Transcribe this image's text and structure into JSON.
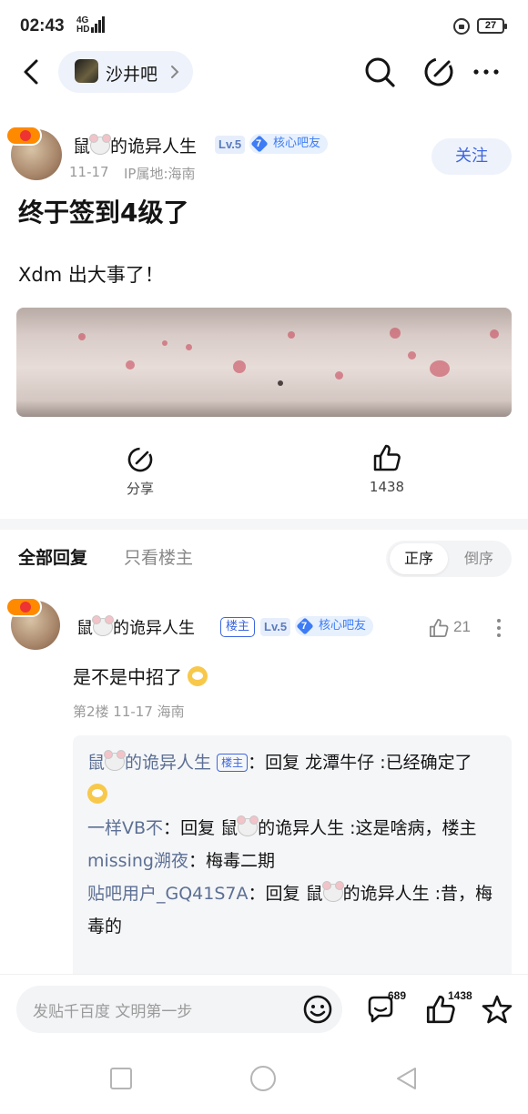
{
  "status_bar": {
    "time": "02:43",
    "signal": "4G",
    "signal_hd": "HD",
    "battery": "27"
  },
  "nav": {
    "forum_name": "沙井吧"
  },
  "post": {
    "author": "鼠",
    "author_suffix": "的诡异人生",
    "level": "Lv.5",
    "core_level": "7",
    "core_label": "核心吧友",
    "date": "11-17",
    "ip": "IP属地:海南",
    "follow_label": "关注",
    "title": "终于签到4级了",
    "body": "Xdm 出大事了！",
    "share_label": "分享",
    "like_count": "1438"
  },
  "replies": {
    "tab_all": "全部回复",
    "tab_host": "只看楼主",
    "order_asc": "正序",
    "order_desc": "倒序"
  },
  "floor": {
    "author": "鼠",
    "author_suffix": "的诡异人生",
    "host_tag": "楼主",
    "level": "Lv.5",
    "core_level": "7",
    "core_label": "核心吧友",
    "likes": "21",
    "text": "是不是中招了",
    "meta": "第2楼  11-17  海南",
    "sub_replies": [
      {
        "who_a": "鼠",
        "who_b": "的诡异人生",
        "tag": "楼主",
        "sep": "：",
        "text_a": "回复 龙潭牛仔 :已经确定了",
        "text_b": ""
      },
      {
        "who_a": "一样VB不",
        "who_b": "",
        "tag": "",
        "sep": "：",
        "text_a": "回复 鼠",
        "text_b": "的诡异人生 :这是啥病，楼主"
      },
      {
        "who_a": "missing溯夜",
        "who_b": "",
        "tag": "",
        "sep": "：",
        "text_a": "梅毒二期",
        "text_b": ""
      },
      {
        "who_a": "贴吧用户_GQ41S7A",
        "who_b": "",
        "tag": "",
        "sep": "：",
        "text_a": "回复 鼠",
        "text_b": "的诡异人生 :昔，梅毒的"
      }
    ]
  },
  "bottom_bar": {
    "placeholder": "发贴千百度 文明第一步",
    "comment_count": "689",
    "like_count": "1438"
  },
  "colors": {
    "accent": "#3d66e0",
    "core_blue": "#3d7cf5",
    "muted": "#9a9a9a"
  }
}
